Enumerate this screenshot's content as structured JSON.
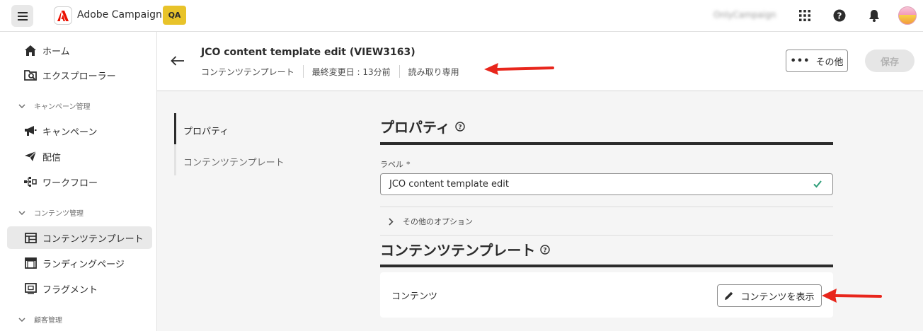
{
  "topbar": {
    "app_title": "Adobe Campaign",
    "env_badge": "QA",
    "org_name": "OnlyCampaign",
    "icons": [
      "menu-icon",
      "adobe-logo-icon",
      "apps-grid-icon",
      "help-icon",
      "notifications-bell-icon",
      "user-avatar"
    ]
  },
  "sidebar": {
    "items": [
      {
        "label": "ホーム",
        "icon": "home-icon"
      },
      {
        "label": "エクスプローラー",
        "icon": "explorer-icon"
      },
      {
        "label": "キャンペーン管理",
        "type": "group"
      },
      {
        "label": "キャンペーン",
        "icon": "megaphone-icon"
      },
      {
        "label": "配信",
        "icon": "send-icon"
      },
      {
        "label": "ワークフロー",
        "icon": "workflow-icon"
      },
      {
        "label": "コンテンツ管理",
        "type": "group"
      },
      {
        "label": "コンテンツテンプレート",
        "icon": "template-icon",
        "active": true
      },
      {
        "label": "ランディングページ",
        "icon": "landing-page-icon"
      },
      {
        "label": "フラグメント",
        "icon": "fragment-icon"
      },
      {
        "label": "顧客管理",
        "type": "group"
      }
    ]
  },
  "header": {
    "title": "JCO content template edit (VIEW3163)",
    "meta": [
      "コンテンツテンプレート",
      "最終変更日 : 13分前",
      "読み取り専用"
    ],
    "more_label": "その他",
    "save_label": "保存"
  },
  "section_nav": {
    "tabs": [
      "プロパティ",
      "コンテンツテンプレート"
    ]
  },
  "properties": {
    "title": "プロパティ",
    "label_field_label": "ラベル",
    "required_marker": "*",
    "label_value": "JCO content template edit",
    "more_options": "その他のオプション"
  },
  "content_template": {
    "title": "コンテンツテンプレート",
    "content_label": "コンテンツ",
    "view_button": "コンテンツを表示"
  },
  "colors": {
    "accent_badge": "#e8c32a",
    "annotation_arrow": "#e8261c",
    "valid_check": "#2d9d78"
  }
}
